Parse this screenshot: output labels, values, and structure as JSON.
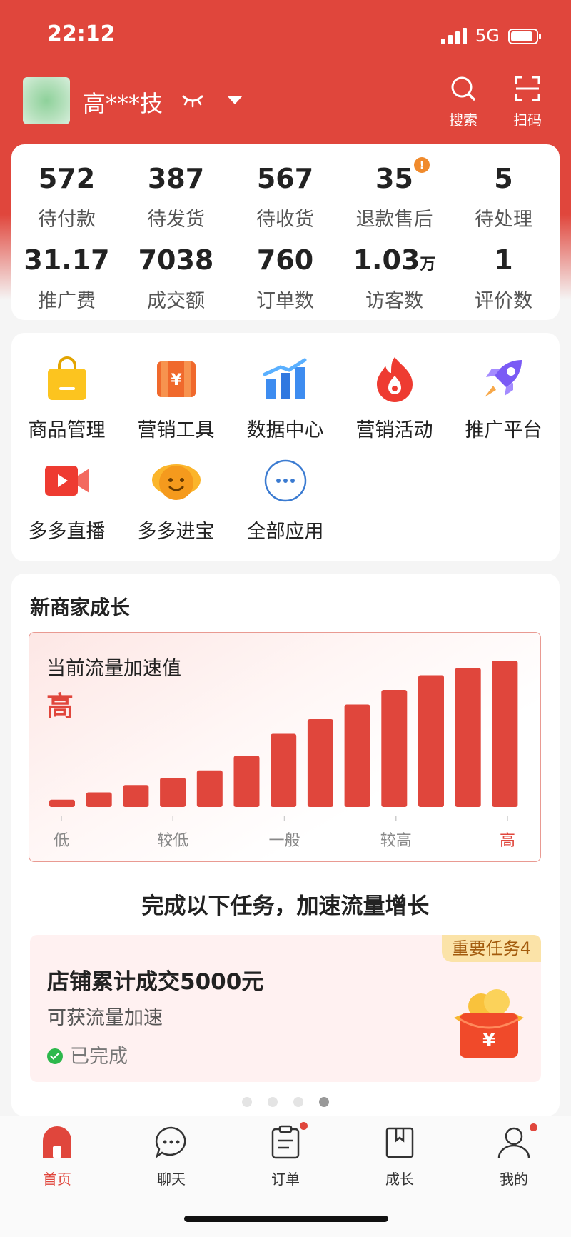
{
  "status_bar": {
    "time": "22:12",
    "network": "5G"
  },
  "header": {
    "shop_name": "高***技",
    "search_label": "搜索",
    "scan_label": "扫码"
  },
  "stats": [
    {
      "value": "572",
      "unit": "",
      "label": "待付款"
    },
    {
      "value": "387",
      "unit": "",
      "label": "待发货"
    },
    {
      "value": "567",
      "unit": "",
      "label": "待收货"
    },
    {
      "value": "35",
      "unit": "",
      "label": "退款售后",
      "alert": "!"
    },
    {
      "value": "5",
      "unit": "",
      "label": "待处理"
    },
    {
      "value": "31.17",
      "unit": "",
      "label": "推广费"
    },
    {
      "value": "7038",
      "unit": "",
      "label": "成交额"
    },
    {
      "value": "760",
      "unit": "",
      "label": "订单数"
    },
    {
      "value": "1.03",
      "unit": "万",
      "label": "访客数"
    },
    {
      "value": "1",
      "unit": "",
      "label": "评价数"
    }
  ],
  "apps": [
    {
      "label": "商品管理",
      "icon": "shopping-bag-icon"
    },
    {
      "label": "营销工具",
      "icon": "coupon-icon"
    },
    {
      "label": "数据中心",
      "icon": "bar-chart-icon"
    },
    {
      "label": "营销活动",
      "icon": "flame-icon"
    },
    {
      "label": "推广平台",
      "icon": "rocket-icon"
    },
    {
      "label": "多多直播",
      "icon": "live-camera-icon"
    },
    {
      "label": "多多进宝",
      "icon": "gold-ingot-icon"
    },
    {
      "label": "全部应用",
      "icon": "more-icon"
    }
  ],
  "growth": {
    "title": "新商家成长",
    "chart_subtitle": "当前流量加速值",
    "current_level": "高",
    "task_heading": "完成以下任务，加速流量增长",
    "task": {
      "badge": "重要任务4",
      "title": "店铺累计成交5000元",
      "subtitle": "可获流量加速",
      "status": "已完成"
    },
    "page_dots": 4,
    "active_dot": 4
  },
  "chart_data": {
    "type": "bar",
    "categories": [
      "低",
      "较低",
      "一般",
      "较高",
      "高"
    ],
    "values": [
      1,
      2,
      3,
      4,
      5,
      7,
      10,
      12,
      14,
      16,
      18,
      19,
      20
    ],
    "ylim": [
      0,
      20
    ],
    "highlight_label": "高",
    "bar_color": "#e0463c"
  },
  "tabbar": [
    {
      "label": "首页",
      "icon": "home-icon",
      "active": true,
      "badge": false
    },
    {
      "label": "聊天",
      "icon": "chat-icon",
      "active": false,
      "badge": false
    },
    {
      "label": "订单",
      "icon": "order-icon",
      "active": false,
      "badge": true
    },
    {
      "label": "成长",
      "icon": "growth-book-icon",
      "active": false,
      "badge": false
    },
    {
      "label": "我的",
      "icon": "profile-icon",
      "active": false,
      "badge": true
    }
  ],
  "colors": {
    "brand": "#e0463c",
    "success": "#2db84c",
    "alert": "#f08a2c"
  }
}
